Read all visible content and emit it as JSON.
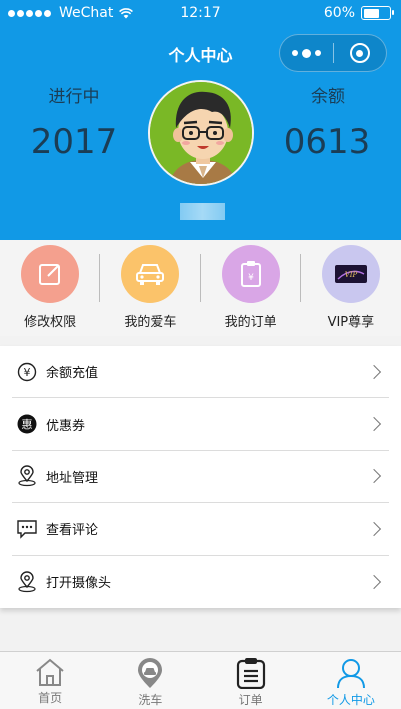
{
  "status_bar": {
    "carrier": "WeChat",
    "time": "12:17",
    "battery": "60%",
    "battery_level": 0.6
  },
  "nav": {
    "title": "个人中心"
  },
  "profile": {
    "left_label": "进行中",
    "left_value": "2017",
    "right_label": "余额",
    "right_value": "0613"
  },
  "quick_actions": [
    {
      "label": "修改权限",
      "icon": "edit-icon",
      "color": "#f4a08e"
    },
    {
      "label": "我的爱车",
      "icon": "car-icon",
      "color": "#fbc36a"
    },
    {
      "label": "我的订单",
      "icon": "clipboard-yen-icon",
      "color": "#d9a6e6"
    },
    {
      "label": "VIP尊享",
      "icon": "vip-card-icon",
      "color": "#c9c7ef"
    }
  ],
  "menu": [
    {
      "label": "余额充值",
      "icon": "yen-circle-icon"
    },
    {
      "label": "优惠券",
      "icon": "coupon-icon"
    },
    {
      "label": "地址管理",
      "icon": "location-pin-icon"
    },
    {
      "label": "查看评论",
      "icon": "comment-icon"
    },
    {
      "label": "打开摄像头",
      "icon": "camera-pin-icon"
    }
  ],
  "tabs": [
    {
      "label": "首页",
      "icon": "home-icon",
      "active": false
    },
    {
      "label": "洗车",
      "icon": "wash-car-icon",
      "active": false
    },
    {
      "label": "订单",
      "icon": "order-icon",
      "active": false
    },
    {
      "label": "个人中心",
      "icon": "user-icon",
      "active": true
    }
  ],
  "colors": {
    "primary": "#1199e6",
    "stat_text": "#1b3d55"
  }
}
